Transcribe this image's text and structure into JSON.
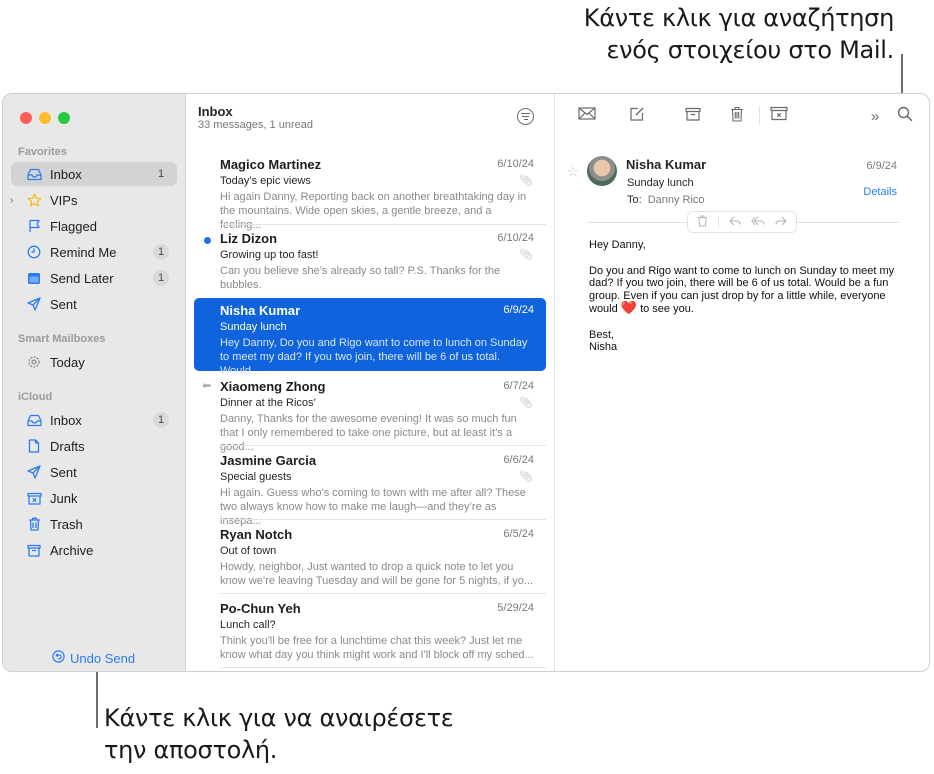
{
  "callouts": {
    "search": [
      "Κάντε κλικ για αναζήτηση",
      "ενός στοιχείου στο Mail."
    ],
    "undo_send": [
      "Κάντε κλικ για να αναιρέσετε",
      "την αποστολή."
    ]
  },
  "colors": {
    "accent": "#2b7cf0",
    "selection": "#0f63dc",
    "unread_dot": "#1f6fe5",
    "traffic_red": "#fe5f57",
    "traffic_yellow": "#febc2e",
    "traffic_green": "#28c840"
  },
  "sidebar": {
    "sections": [
      {
        "label": "Favorites",
        "items": [
          {
            "label": "Inbox",
            "icon": "inbox-icon",
            "badge": "1",
            "selected": true
          },
          {
            "label": "VIPs",
            "icon": "star-icon",
            "badge": "",
            "disclosure": true
          },
          {
            "label": "Flagged",
            "icon": "flag-icon",
            "badge": ""
          },
          {
            "label": "Remind Me",
            "icon": "clock-icon",
            "badge": "1"
          },
          {
            "label": "Send Later",
            "icon": "calendar-icon",
            "badge": "1"
          },
          {
            "label": "Sent",
            "icon": "paperplane-icon",
            "badge": ""
          }
        ]
      },
      {
        "label": "Smart Mailboxes",
        "items": [
          {
            "label": "Today",
            "icon": "gear-icon",
            "badge": ""
          }
        ]
      },
      {
        "label": "iCloud",
        "items": [
          {
            "label": "Inbox",
            "icon": "inbox-icon",
            "badge": "1"
          },
          {
            "label": "Drafts",
            "icon": "document-icon",
            "badge": ""
          },
          {
            "label": "Sent",
            "icon": "paperplane-icon",
            "badge": ""
          },
          {
            "label": "Junk",
            "icon": "junk-icon",
            "badge": ""
          },
          {
            "label": "Trash",
            "icon": "trash-icon",
            "badge": ""
          },
          {
            "label": "Archive",
            "icon": "archive-icon",
            "badge": ""
          }
        ]
      }
    ],
    "undo_send_label": "Undo Send"
  },
  "message_list": {
    "title": "Inbox",
    "subtitle": "33 messages, 1 unread",
    "messages": [
      {
        "from": "Magico Martinez",
        "date": "6/10/24",
        "subject": "Today’s epic views",
        "preview": "Hi again Danny, Reporting back on another breathtaking day in the mountains. Wide open skies, a gentle breeze, and a feeling...",
        "attachment": true,
        "unread": false,
        "replied": false,
        "selected": false
      },
      {
        "from": "Liz Dizon",
        "date": "6/10/24",
        "subject": "Growing up too fast!",
        "preview": "Can you believe she’s already so tall? P.S. Thanks for the bubbles.",
        "attachment": true,
        "unread": true,
        "replied": false,
        "selected": false
      },
      {
        "from": "Nisha Kumar",
        "date": "6/9/24",
        "subject": "Sunday lunch",
        "preview": "Hey Danny, Do you and Rigo want to come to lunch on Sunday to meet my dad? If you two join, there will be 6 of us total. Would...",
        "attachment": false,
        "unread": false,
        "replied": false,
        "selected": true
      },
      {
        "from": "Xiaomeng Zhong",
        "date": "6/7/24",
        "subject": "Dinner at the Ricos’",
        "preview": "Danny, Thanks for the awesome evening! It was so much fun that I only remembered to take one picture, but at least it’s a good...",
        "attachment": true,
        "unread": false,
        "replied": true,
        "selected": false
      },
      {
        "from": "Jasmine Garcia",
        "date": "6/6/24",
        "subject": "Special guests",
        "preview": "Hi again. Guess who’s coming to town with me after all? These two always know how to make me laugh—and they’re as insepa...",
        "attachment": true,
        "unread": false,
        "replied": false,
        "selected": false
      },
      {
        "from": "Ryan Notch",
        "date": "6/5/24",
        "subject": "Out of town",
        "preview": "Howdy, neighbor, Just wanted to drop a quick note to let you know we’re leaving Tuesday and will be gone for 5 nights, if yo...",
        "attachment": false,
        "unread": false,
        "replied": false,
        "selected": false
      },
      {
        "from": "Po-Chun Yeh",
        "date": "5/29/24",
        "subject": "Lunch call?",
        "preview": "Think you'll be free for a lunchtime chat this week? Just let me know what day you think might work and I'll block off my sched...",
        "attachment": false,
        "unread": false,
        "replied": false,
        "selected": false
      }
    ]
  },
  "reader": {
    "toolbar": [
      "envelope-icon",
      "compose-icon",
      "archive-icon",
      "trash-icon",
      "junk-icon",
      "more-chevrons-icon",
      "search-icon"
    ],
    "from": "Nisha Kumar",
    "subject": "Sunday lunch",
    "to_label": "To:",
    "to_name": "Danny Rico",
    "date": "6/9/24",
    "details_label": "Details",
    "body": {
      "greeting": "Hey Danny,",
      "paragraph_before_emoji": "Do you and Rigo want to come to lunch on Sunday to meet my dad? If you two join, there will be 6 of us total. Would be a fun group. Even if you can just drop by for a little while, everyone would",
      "emoji": "❤️",
      "paragraph_after_emoji": "to see you.",
      "signoff": "Best,",
      "signature": "Nisha"
    }
  }
}
